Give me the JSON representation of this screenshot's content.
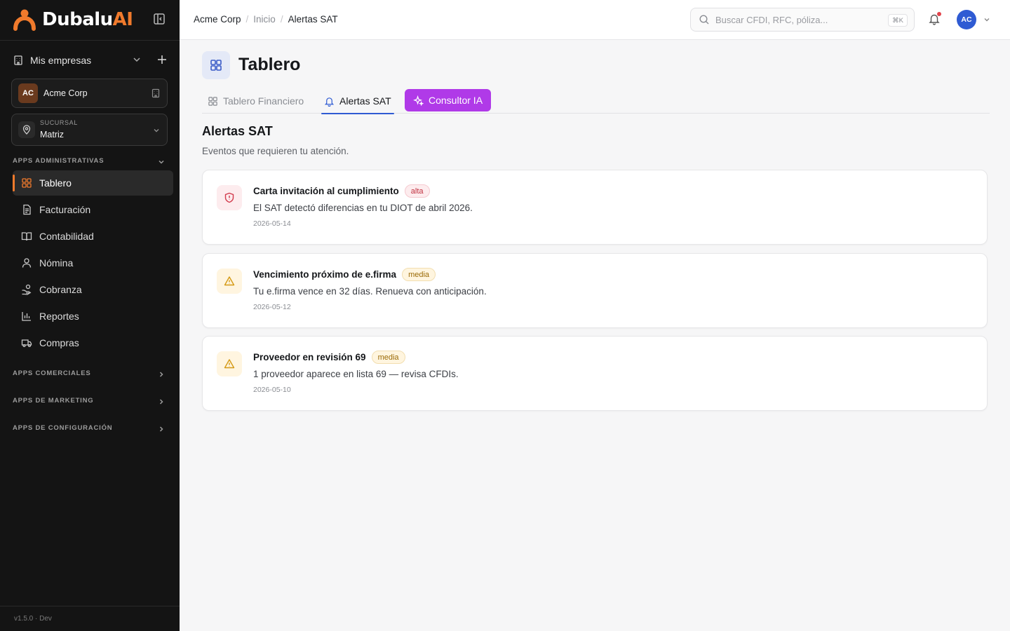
{
  "brand": {
    "name_main": "Dubalu",
    "name_accent": "AI"
  },
  "sidebar": {
    "companies_label": "Mis empresas",
    "company": {
      "initials": "AC",
      "name": "Acme Corp"
    },
    "branch": {
      "caption": "SUCURSAL",
      "value": "Matriz"
    },
    "sections": [
      {
        "label": "APPS ADMINISTRATIVAS",
        "expanded": true
      },
      {
        "label": "APPS COMERCIALES",
        "expanded": false
      },
      {
        "label": "APPS DE MARKETING",
        "expanded": false
      },
      {
        "label": "APPS DE CONFIGURACIÓN",
        "expanded": false
      }
    ],
    "items": [
      {
        "label": "Tablero",
        "icon": "grid-icon",
        "active": true
      },
      {
        "label": "Facturación",
        "icon": "document-icon"
      },
      {
        "label": "Contabilidad",
        "icon": "book-icon"
      },
      {
        "label": "Nómina",
        "icon": "user-icon"
      },
      {
        "label": "Cobranza",
        "icon": "hand-coins-icon"
      },
      {
        "label": "Reportes",
        "icon": "bar-chart-icon"
      },
      {
        "label": "Compras",
        "icon": "truck-icon"
      }
    ],
    "version": "v1.5.0 · Dev"
  },
  "topbar": {
    "breadcrumb": [
      "Acme Corp",
      "Inicio",
      "Alertas SAT"
    ],
    "search_placeholder": "Buscar CFDI, RFC, póliza...",
    "search_shortcut": "⌘K",
    "avatar_initials": "AC"
  },
  "page": {
    "title": "Tablero",
    "tabs": [
      {
        "label": "Tablero Financiero"
      },
      {
        "label": "Alertas SAT",
        "active": true
      },
      {
        "label": "Consultor IA"
      }
    ],
    "section_title": "Alertas SAT",
    "section_subtitle": "Eventos que requieren tu atención."
  },
  "alerts": [
    {
      "title": "Carta invitación al cumplimiento",
      "severity": "alta",
      "description": "El SAT detectó diferencias en tu DIOT de abril 2026.",
      "date": "2026-05-14",
      "icon": "shield-alert-icon"
    },
    {
      "title": "Vencimiento próximo de e.firma",
      "severity": "media",
      "description": "Tu e.firma vence en 32 días. Renueva con anticipación.",
      "date": "2026-05-12",
      "icon": "warning-triangle-icon"
    },
    {
      "title": "Proveedor en revisión 69",
      "severity": "media",
      "description": "1 proveedor aparece en lista 69 — revisa CFDIs.",
      "date": "2026-05-10",
      "icon": "warning-triangle-icon"
    }
  ],
  "colors": {
    "sidebar_bg": "#141414",
    "accent_orange": "#f07a2c",
    "primary_blue": "#2f5bd3",
    "ia_purple": "#b03ae8",
    "high_red": "#d23a4c",
    "medium_amber": "#d59a15"
  }
}
